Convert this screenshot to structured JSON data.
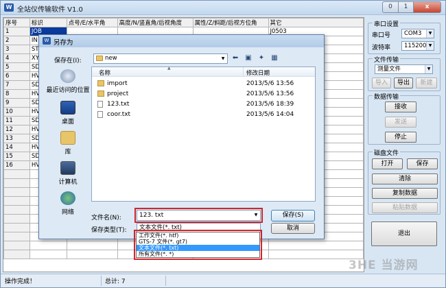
{
  "window": {
    "title": "全站仪传输软件  V1.0",
    "min": "0",
    "max": "1",
    "close": "x"
  },
  "grid": {
    "headers": [
      "序号",
      "标识",
      "点号/E/水平角",
      "高度/N/竖直角/后视角度",
      "属性/Z/斜距/后视方位角",
      "其它"
    ],
    "rows": [
      {
        "no": "1",
        "id": "JOB",
        "other": "J0503",
        "selected": true
      },
      {
        "no": "2",
        "id": "IN",
        "other": ""
      },
      {
        "no": "3",
        "id": "ST",
        "other": ""
      },
      {
        "no": "4",
        "id": "XY",
        "other": ""
      },
      {
        "no": "5",
        "id": "SD",
        "other": ""
      },
      {
        "no": "6",
        "id": "HV",
        "other": ""
      },
      {
        "no": "7",
        "id": "SD",
        "other": ""
      },
      {
        "no": "8",
        "id": "HV",
        "other": ""
      },
      {
        "no": "9",
        "id": "SD",
        "other": ""
      },
      {
        "no": "10",
        "id": "HV",
        "other": ""
      },
      {
        "no": "11",
        "id": "SD",
        "other": ""
      },
      {
        "no": "12",
        "id": "HV",
        "other": ""
      },
      {
        "no": "13",
        "id": "SD",
        "other": ""
      },
      {
        "no": "14",
        "id": "HV",
        "other": ""
      },
      {
        "no": "15",
        "id": "SD",
        "other": ""
      },
      {
        "no": "16",
        "id": "HV",
        "other": ""
      },
      {
        "no": "",
        "id": "",
        "other": ""
      },
      {
        "no": "",
        "id": "",
        "other": ""
      },
      {
        "no": "",
        "id": "",
        "other": ""
      },
      {
        "no": "",
        "id": "",
        "other": ""
      },
      {
        "no": "",
        "id": "",
        "other": ""
      },
      {
        "no": "",
        "id": "",
        "other": ""
      },
      {
        "no": "",
        "id": "",
        "other": ""
      },
      {
        "no": "",
        "id": "",
        "other": ""
      },
      {
        "no": "",
        "id": "",
        "other": ""
      },
      {
        "no": "",
        "id": "",
        "other": ""
      }
    ]
  },
  "panel": {
    "serial": {
      "title": "串口设置",
      "port_label": "串口号",
      "port_value": "COM3",
      "baud_label": "波特率",
      "baud_value": "115200"
    },
    "transfer": {
      "title": "文件传输",
      "type_value": "测量文件",
      "import": "导入",
      "export": "导出",
      "new": "新建"
    },
    "data": {
      "title": "数据传输",
      "receive": "接收",
      "send": "发送",
      "stop": "停止"
    },
    "disk": {
      "title": "磁盘文件",
      "open": "打开",
      "save": "保存",
      "clear": "清除",
      "copy": "复制数据",
      "paste": "粘贴数据"
    },
    "exit": "退出"
  },
  "status": {
    "message": "操作完成！",
    "total": "总计: 7"
  },
  "dialog": {
    "title": "另存为",
    "save_in_label": "保存在(I):",
    "save_in_value": "new",
    "toolbar": {
      "back": "⬅",
      "up": "▣",
      "new_folder": "✦",
      "view": "▦"
    },
    "places": [
      {
        "label": "最近访问的位置"
      },
      {
        "label": "桌面"
      },
      {
        "label": "库"
      },
      {
        "label": "计算机"
      },
      {
        "label": "网络"
      }
    ],
    "columns": {
      "name": "名称",
      "modified": "修改日期"
    },
    "files": [
      {
        "name": "import",
        "modified": "2013/5/6 13:56",
        "kind": "folder"
      },
      {
        "name": "project",
        "modified": "2013/5/6 13:56",
        "kind": "folder"
      },
      {
        "name": "123.txt",
        "modified": "2013/5/6 18:39",
        "kind": "txt"
      },
      {
        "name": "coor.txt",
        "modified": "2013/5/6 14:04",
        "kind": "txt"
      }
    ],
    "filename_label": "文件名(N):",
    "filename_value": "123. txt",
    "filetype_label": "保存类型(T):",
    "filetype_value": "文本文件(*. txt)",
    "save_button": "保存(S)",
    "cancel_button": "取消",
    "filetype_options": [
      {
        "label": "工作文件(*. htf)",
        "selected": false
      },
      {
        "label": "GTS-7 文件(*. gt7)",
        "selected": false
      },
      {
        "label": "文本文件(*. txt)",
        "selected": true
      },
      {
        "label": "所有文件(*. *)",
        "selected": false
      }
    ]
  },
  "watermark": "3HE 当游网",
  "colors": {
    "selection": "#0a3a9c",
    "highlight_box": "#d0242a",
    "dropdown_selected": "#3399ff"
  }
}
